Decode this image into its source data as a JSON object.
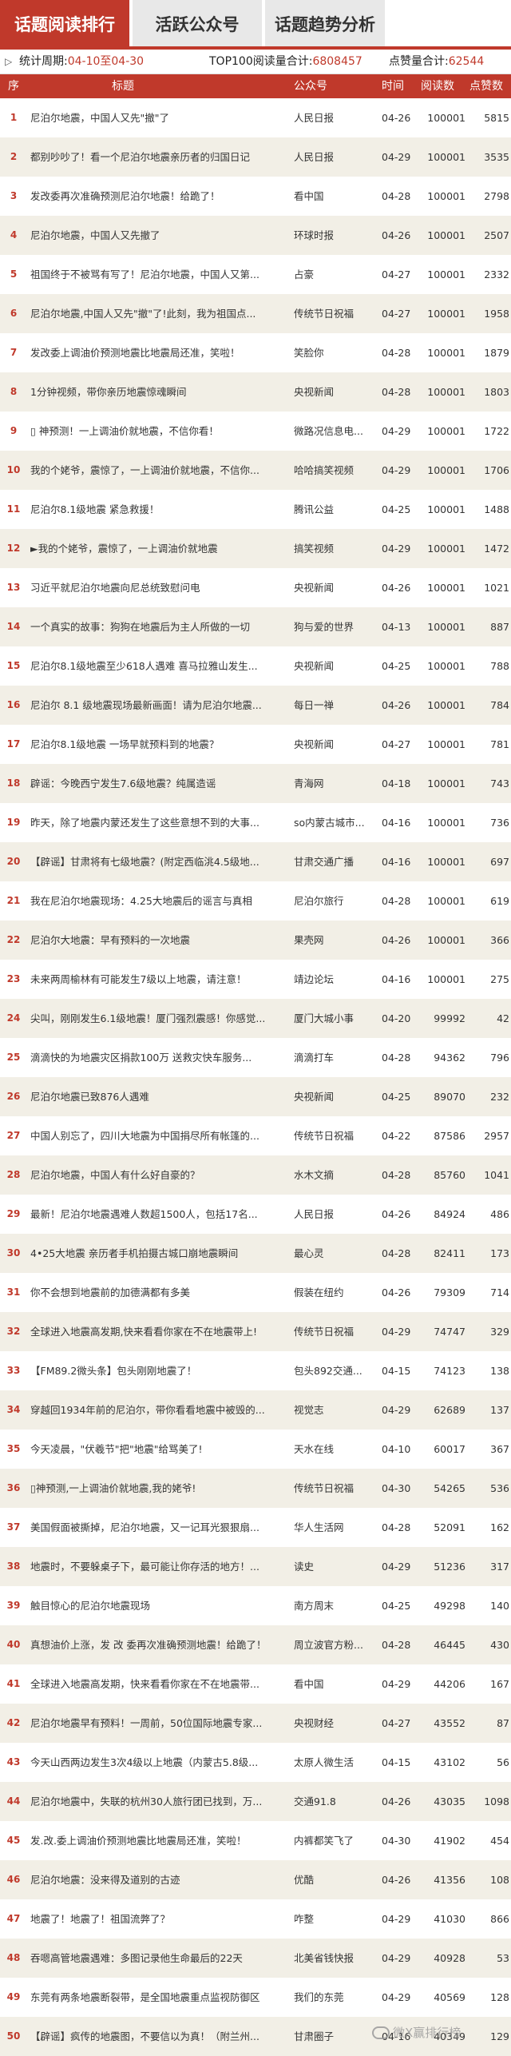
{
  "tabs": [
    {
      "label": "话题阅读排行",
      "active": true
    },
    {
      "label": "活跃公众号",
      "active": false
    },
    {
      "label": "话题趋势分析",
      "active": false
    }
  ],
  "stats": {
    "arrow_icon": "triangle-right-icon",
    "period_label": "统计周期:",
    "period_value": "04-10至04-30",
    "reads_label": "TOP100阅读量合计:",
    "reads_value": "6808457",
    "likes_label": "点赞量合计:",
    "likes_value": "62544"
  },
  "table": {
    "headers": {
      "rank": "序",
      "title": "标题",
      "account": "公众号",
      "time": "时间",
      "reads": "阅读数",
      "likes": "点赞数"
    },
    "rows": [
      {
        "rank": "1",
        "title": "尼泊尔地震，中国人又先\"撤\"了",
        "account": "人民日报",
        "date": "04-26",
        "reads": "100001",
        "likes": "5815"
      },
      {
        "rank": "2",
        "title": "都别吵吵了！看一个尼泊尔地震亲历者的归国日记",
        "account": "人民日报",
        "date": "04-29",
        "reads": "100001",
        "likes": "3535"
      },
      {
        "rank": "3",
        "title": "发改委再次准确预测尼泊尔地震！给跪了！",
        "account": "看中国",
        "date": "04-28",
        "reads": "100001",
        "likes": "2798"
      },
      {
        "rank": "4",
        "title": "尼泊尔地震，中国人又先撤了",
        "account": "环球时报",
        "date": "04-26",
        "reads": "100001",
        "likes": "2507"
      },
      {
        "rank": "5",
        "title": "祖国终于不被骂有写了！尼泊尔地震，中国人又第...",
        "account": "占豪",
        "date": "04-27",
        "reads": "100001",
        "likes": "2332"
      },
      {
        "rank": "6",
        "title": "尼泊尔地震,中国人又先\"撤\"了!此刻，我为祖国点...",
        "account": "传统节日祝福",
        "date": "04-27",
        "reads": "100001",
        "likes": "1958"
      },
      {
        "rank": "7",
        "title": "发改委上调油价预测地震比地震局还准，笑啦！",
        "account": "笑脸你",
        "date": "04-28",
        "reads": "100001",
        "likes": "1879"
      },
      {
        "rank": "8",
        "title": "1分钟视频，带你亲历地震惊魂瞬间",
        "account": "央视新闻",
        "date": "04-28",
        "reads": "100001",
        "likes": "1803"
      },
      {
        "rank": "9",
        "title": "▯ 神预测！一上调油价就地震，不信你看！",
        "account": "微路况信息电...",
        "date": "04-29",
        "reads": "100001",
        "likes": "1722"
      },
      {
        "rank": "10",
        "title": "我的个姥爷，震惊了，一上调油价就地震，不信你...",
        "account": "哈哈搞笑视频",
        "date": "04-29",
        "reads": "100001",
        "likes": "1706"
      },
      {
        "rank": "11",
        "title": "尼泊尔8.1级地震 紧急救援！",
        "account": "腾讯公益",
        "date": "04-25",
        "reads": "100001",
        "likes": "1488"
      },
      {
        "rank": "12",
        "title": "►我的个姥爷，震惊了，一上调油价就地震",
        "account": "搞笑视频",
        "date": "04-29",
        "reads": "100001",
        "likes": "1472"
      },
      {
        "rank": "13",
        "title": "习近平就尼泊尔地震向尼总统致慰问电",
        "account": "央视新闻",
        "date": "04-26",
        "reads": "100001",
        "likes": "1021"
      },
      {
        "rank": "14",
        "title": "一个真实的故事：狗狗在地震后为主人所做的一切",
        "account": "狗与爱的世界",
        "date": "04-13",
        "reads": "100001",
        "likes": "887"
      },
      {
        "rank": "15",
        "title": "尼泊尔8.1级地震至少618人遇难 喜马拉雅山发生...",
        "account": "央视新闻",
        "date": "04-25",
        "reads": "100001",
        "likes": "788"
      },
      {
        "rank": "16",
        "title": "尼泊尔 8.1 级地震现场最新画面！请为尼泊尔地震...",
        "account": "每日一禅",
        "date": "04-26",
        "reads": "100001",
        "likes": "784"
      },
      {
        "rank": "17",
        "title": "尼泊尔8.1级地震 一场早就预料到的地震？",
        "account": "央视新闻",
        "date": "04-27",
        "reads": "100001",
        "likes": "781"
      },
      {
        "rank": "18",
        "title": "辟谣：今晚西宁发生7.6级地震？纯属造谣",
        "account": "青海网",
        "date": "04-18",
        "reads": "100001",
        "likes": "743"
      },
      {
        "rank": "19",
        "title": "昨天，除了地震内蒙还发生了这些意想不到的大事...",
        "account": "so内蒙古城市...",
        "date": "04-16",
        "reads": "100001",
        "likes": "736"
      },
      {
        "rank": "20",
        "title": "【辟谣】甘肃将有七级地震？(附定西临洮4.5级地...",
        "account": "甘肃交通广播",
        "date": "04-16",
        "reads": "100001",
        "likes": "697"
      },
      {
        "rank": "21",
        "title": "我在尼泊尔地震现场：4.25大地震后的谣言与真相",
        "account": "尼泊尔旅行",
        "date": "04-28",
        "reads": "100001",
        "likes": "619"
      },
      {
        "rank": "22",
        "title": "尼泊尔大地震：早有预料的一次地震",
        "account": "果壳网",
        "date": "04-26",
        "reads": "100001",
        "likes": "366"
      },
      {
        "rank": "23",
        "title": "未来两周榆林有可能发生7级以上地震，请注意！",
        "account": "靖边论坛",
        "date": "04-16",
        "reads": "100001",
        "likes": "275"
      },
      {
        "rank": "24",
        "title": "尖叫，刚刚发生6.1级地震！厦门强烈震感！你感觉...",
        "account": "厦门大城小事",
        "date": "04-20",
        "reads": "99992",
        "likes": "42"
      },
      {
        "rank": "25",
        "title": "滴滴快的为地震灾区捐款100万 送救灾快车服务...",
        "account": "滴滴打车",
        "date": "04-28",
        "reads": "94362",
        "likes": "796"
      },
      {
        "rank": "26",
        "title": "尼泊尔地震已致876人遇难",
        "account": "央视新闻",
        "date": "04-25",
        "reads": "89070",
        "likes": "232"
      },
      {
        "rank": "27",
        "title": "中国人别忘了，四川大地震为中国捐尽所有帐篷的...",
        "account": "传统节日祝福",
        "date": "04-22",
        "reads": "87586",
        "likes": "2957"
      },
      {
        "rank": "28",
        "title": "尼泊尔地震，中国人有什么好自豪的？",
        "account": "水木文摘",
        "date": "04-28",
        "reads": "85760",
        "likes": "1041"
      },
      {
        "rank": "29",
        "title": "最新！尼泊尔地震遇难人数超1500人，包括17名...",
        "account": "人民日报",
        "date": "04-26",
        "reads": "84924",
        "likes": "486"
      },
      {
        "rank": "30",
        "title": "4•25大地震 亲历者手机拍摄古城口崩地震瞬间",
        "account": "最心灵",
        "date": "04-28",
        "reads": "82411",
        "likes": "173"
      },
      {
        "rank": "31",
        "title": "你不会想到地震前的加德满都有多美",
        "account": "假装在纽约",
        "date": "04-26",
        "reads": "79309",
        "likes": "714"
      },
      {
        "rank": "32",
        "title": "全球进入地震高发期,快来看看你家在不在地震带上!",
        "account": "传统节日祝福",
        "date": "04-29",
        "reads": "74747",
        "likes": "329"
      },
      {
        "rank": "33",
        "title": "【FM89.2微头条】包头刚刚地震了！",
        "account": "包头892交通...",
        "date": "04-15",
        "reads": "74123",
        "likes": "138"
      },
      {
        "rank": "34",
        "title": "穿越回1934年前的尼泊尔，带你看看地震中被毁的...",
        "account": "视觉志",
        "date": "04-29",
        "reads": "62689",
        "likes": "137"
      },
      {
        "rank": "35",
        "title": "今天凌晨，\"伏羲节\"把\"地震\"给骂美了!",
        "account": "天水在线",
        "date": "04-10",
        "reads": "60017",
        "likes": "367"
      },
      {
        "rank": "36",
        "title": "▯神预测,一上调油价就地震,我的姥爷!",
        "account": "传统节日祝福",
        "date": "04-30",
        "reads": "54265",
        "likes": "536"
      },
      {
        "rank": "37",
        "title": "美国假面被撕掉，尼泊尔地震，又一记耳光狠狠扇...",
        "account": "华人生活网",
        "date": "04-28",
        "reads": "52091",
        "likes": "162"
      },
      {
        "rank": "38",
        "title": "地震时，不要躲桌子下，最可能让你存活的地方！...",
        "account": "读史",
        "date": "04-29",
        "reads": "51236",
        "likes": "317"
      },
      {
        "rank": "39",
        "title": "触目惊心的尼泊尔地震现场",
        "account": "南方周末",
        "date": "04-25",
        "reads": "49298",
        "likes": "140"
      },
      {
        "rank": "40",
        "title": "真想油价上涨，发 改 委再次准确预测地震！给跪了！",
        "account": "周立波官方粉...",
        "date": "04-28",
        "reads": "46445",
        "likes": "430"
      },
      {
        "rank": "41",
        "title": "全球进入地震高发期，快来看看你家在不在地震带...",
        "account": "看中国",
        "date": "04-29",
        "reads": "44206",
        "likes": "167"
      },
      {
        "rank": "42",
        "title": "尼泊尔地震早有预料！一周前，50位国际地震专家...",
        "account": "央视财经",
        "date": "04-27",
        "reads": "43552",
        "likes": "87"
      },
      {
        "rank": "43",
        "title": "今天山西两边发生3次4级以上地震（内蒙古5.8级...",
        "account": "太原人微生活",
        "date": "04-15",
        "reads": "43102",
        "likes": "56"
      },
      {
        "rank": "44",
        "title": "尼泊尔地震中，失联的杭州30人旅行团已找到，万...",
        "account": "交通91.8",
        "date": "04-26",
        "reads": "43035",
        "likes": "1098"
      },
      {
        "rank": "45",
        "title": "发.改.委上调油价预测地震比地震局还准，笑啦！",
        "account": "内裤都笑飞了",
        "date": "04-30",
        "reads": "41902",
        "likes": "454"
      },
      {
        "rank": "46",
        "title": "尼泊尔地震：没来得及道别的古迹",
        "account": "优酷",
        "date": "04-26",
        "reads": "41356",
        "likes": "108"
      },
      {
        "rank": "47",
        "title": "地震了！地震了！祖国流弊了？",
        "account": "咋整",
        "date": "04-29",
        "reads": "41030",
        "likes": "866"
      },
      {
        "rank": "48",
        "title": "吞嗯高管地震遇难：多图记录他生命最后的22天",
        "account": "北美省钱快报",
        "date": "04-29",
        "reads": "40928",
        "likes": "53"
      },
      {
        "rank": "49",
        "title": "东莞有两条地震断裂带，是全国地震重点监视防御区",
        "account": "我们的东莞",
        "date": "04-29",
        "reads": "40569",
        "likes": "128"
      },
      {
        "rank": "50",
        "title": "【辟谣】疯传的地震图，不要信以为真！（附兰州...",
        "account": "甘肃圈子",
        "date": "04-16",
        "reads": "40349",
        "likes": "129"
      }
    ]
  },
  "watermark": {
    "text": "微X赢排行榜",
    "icon": "wechat-icon"
  }
}
